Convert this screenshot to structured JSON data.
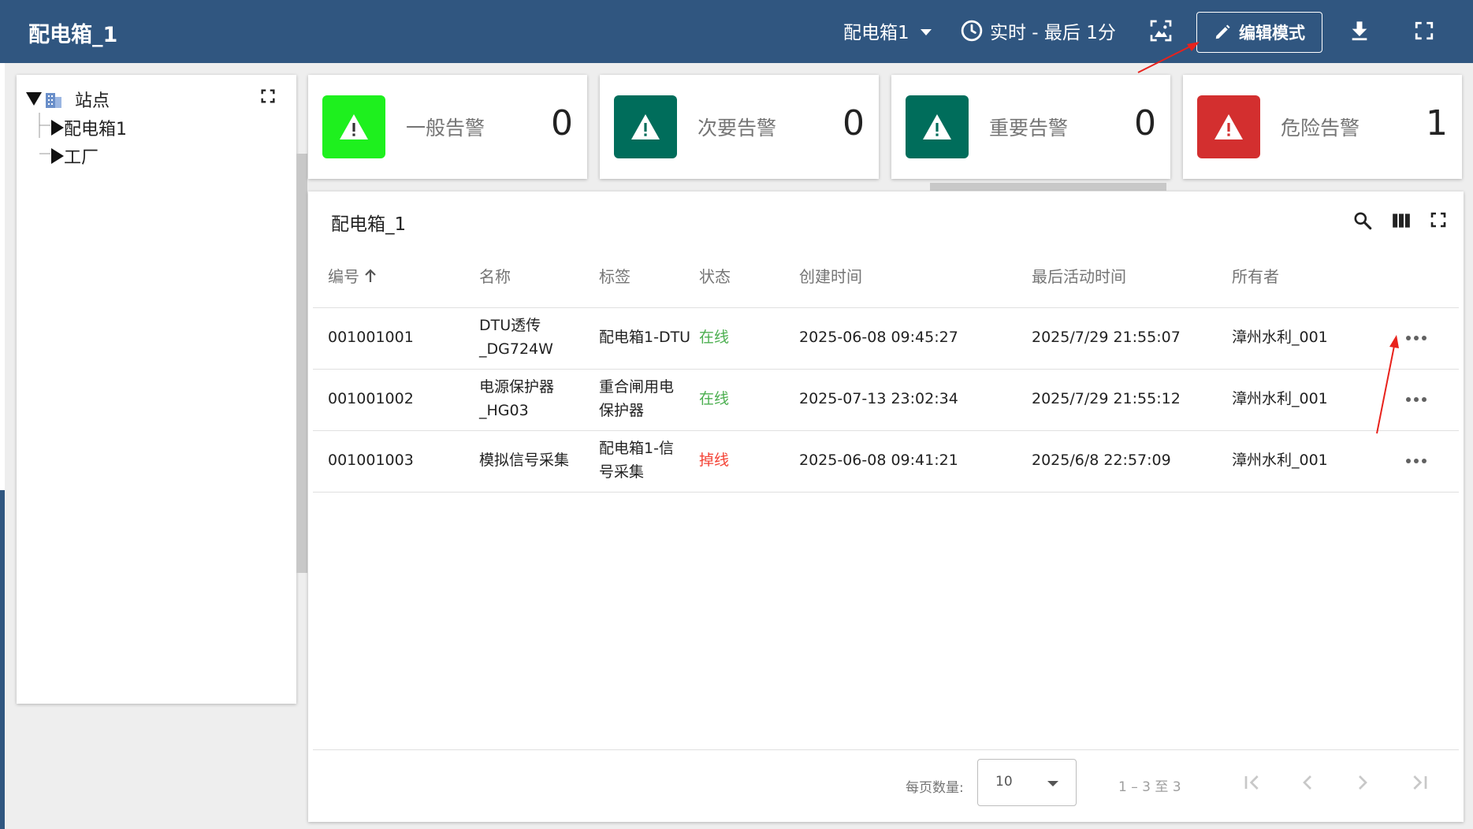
{
  "header": {
    "title": "配电箱_1",
    "device_select": "配电箱1",
    "time_window": "实时 - 最后 1分",
    "edit_label": "编辑模式"
  },
  "tree": {
    "root": "站点",
    "children": [
      "配电箱1",
      "工厂"
    ]
  },
  "alarms": [
    {
      "label": "一般告警",
      "count": "0",
      "color": "#1ef01e"
    },
    {
      "label": "次要告警",
      "count": "0",
      "color": "#006d5b"
    },
    {
      "label": "重要告警",
      "count": "0",
      "color": "#006d5b"
    },
    {
      "label": "危险告警",
      "count": "1",
      "color": "#d32f2f"
    }
  ],
  "table": {
    "title": "配电箱_1",
    "columns": [
      "编号",
      "名称",
      "标签",
      "状态",
      "创建时间",
      "最后活动时间",
      "所有者"
    ],
    "rows": [
      {
        "id": "001001001",
        "name1": "DTU透传",
        "name2": "_DG724W",
        "tag1": "配电箱1-DTU",
        "tag2": "",
        "status": "在线",
        "created": "2025-06-08 09:45:27",
        "last": "2025/7/29 21:55:07",
        "owner": "漳州水利_001"
      },
      {
        "id": "001001002",
        "name1": "电源保护器",
        "name2": "_HG03",
        "tag1": "重合闸用电",
        "tag2": "保护器",
        "status": "在线",
        "created": "2025-07-13 23:02:34",
        "last": "2025/7/29 21:55:12",
        "owner": "漳州水利_001"
      },
      {
        "id": "001001003",
        "name1": "模拟信号采集",
        "name2": "",
        "tag1": "配电箱1-信",
        "tag2": "号采集",
        "status": "掉线",
        "created": "2025-06-08 09:41:21",
        "last": "2025/6/8 22:57:09",
        "owner": "漳州水利_001"
      }
    ],
    "status_colors": {
      "online": "#4caf50",
      "offline": "#f44336"
    }
  },
  "pagination": {
    "page_size_label": "每页数量:",
    "page_size": "10",
    "range": "1 – 3 至 3"
  },
  "colors": {
    "brand": "#305680",
    "annotation": "#e8221c"
  }
}
